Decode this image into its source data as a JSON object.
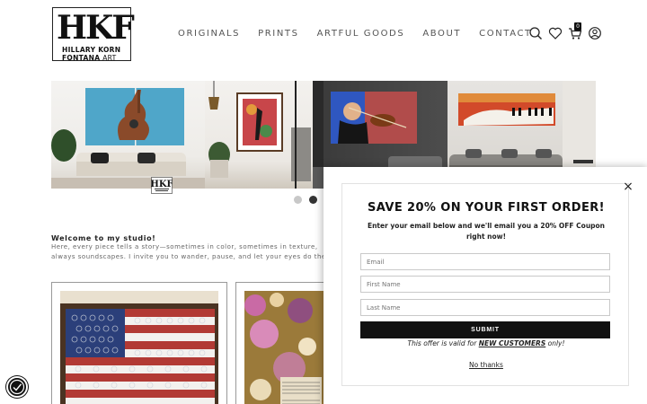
{
  "brand": {
    "mark": "HKF",
    "line1": "HILLARY KORN",
    "line2_bold": "FONTANA",
    "line2_light": "ART"
  },
  "nav": {
    "items": [
      "ORIGINALS",
      "PRINTS",
      "ARTFUL GOODS",
      "ABOUT",
      "CONTACT"
    ]
  },
  "header_icons": {
    "search": "search-icon",
    "wishlist": "heart-icon",
    "cart": "cart-icon",
    "cart_count": "0",
    "account": "user-icon"
  },
  "carousel": {
    "slide_count": 2,
    "active_index": 1
  },
  "welcome": {
    "heading": "Welcome to my studio!",
    "body": "Here, every piece tells a story—sometimes in color, sometimes in texture, always soundscapes. I invite you to wander, pause, and let your eyes do the listening. C"
  },
  "popup": {
    "title": "SAVE 20% ON YOUR FIRST ORDER!",
    "subtitle": "Enter your email below and we'll email you a 20% OFF Coupon right now!",
    "fields": {
      "email_placeholder": "Email",
      "first_name_placeholder": "First Name",
      "last_name_placeholder": "Last Name"
    },
    "submit_label": "SUBMIT",
    "offer_prefix": "This offer is valid for ",
    "offer_highlight": "NEW CUSTOMERS",
    "offer_suffix": " only!",
    "decline_label": "No thanks",
    "close_glyph": "×"
  },
  "colors": {
    "accent": "#111111",
    "nav_text": "#555555",
    "body_text": "#666666"
  }
}
